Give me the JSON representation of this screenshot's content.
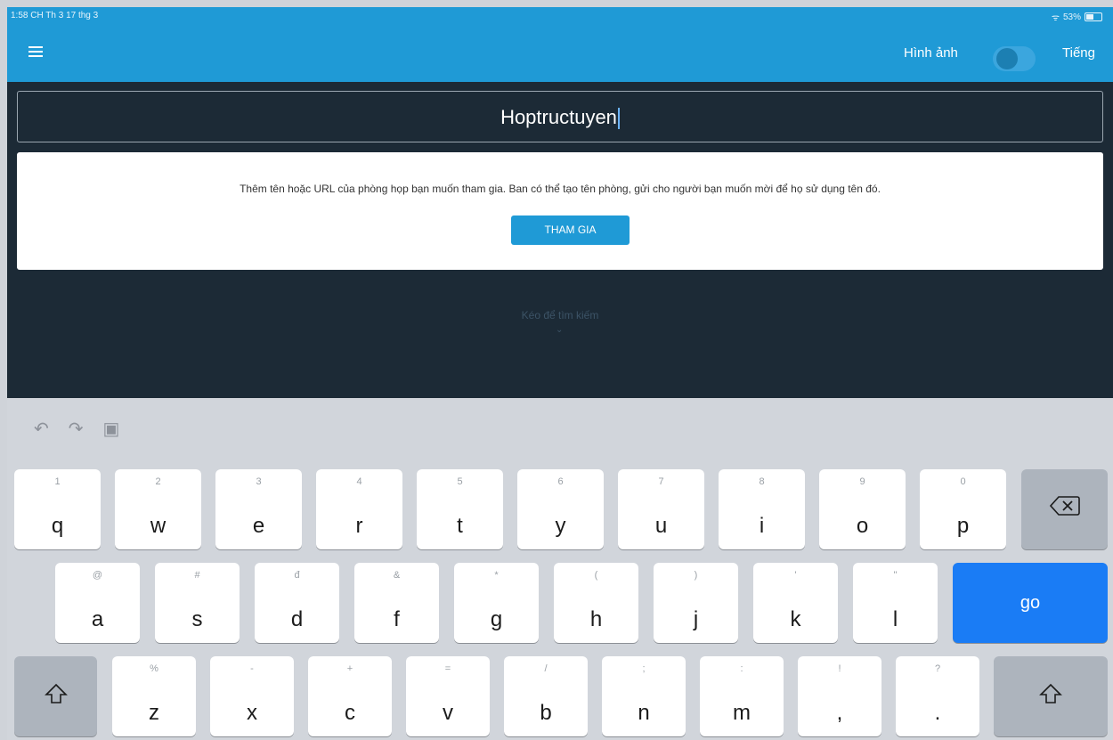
{
  "status_bar": {
    "time_date": "1:58 CH  Th 3 17 thg 3",
    "battery": "53%",
    "battery_level": 0.53
  },
  "header": {
    "menu_icon": "hamburger-menu-icon",
    "left_label": "Hình ảnh",
    "right_label": "Tiếng",
    "accent_color": "#1f9ad6"
  },
  "main": {
    "room_input_value": "Hoptructuyen",
    "info_text": "Thêm tên hoặc URL của phòng họp bạn muốn tham gia. Ban có thể tạo tên phòng, gửi cho người bạn muốn mời để họ sử dụng tên đó.",
    "join_button_label": "THAM GIA",
    "swipe_hint": "Kéo để tìm kiếm",
    "background_color": "#1c2a36"
  },
  "keyboard": {
    "toolbar_icons": [
      "undo-icon",
      "redo-icon",
      "paste-icon"
    ],
    "row1": [
      {
        "hint": "1",
        "label": "q"
      },
      {
        "hint": "2",
        "label": "w"
      },
      {
        "hint": "3",
        "label": "e"
      },
      {
        "hint": "4",
        "label": "r"
      },
      {
        "hint": "5",
        "label": "t"
      },
      {
        "hint": "6",
        "label": "y"
      },
      {
        "hint": "7",
        "label": "u"
      },
      {
        "hint": "8",
        "label": "i"
      },
      {
        "hint": "9",
        "label": "o"
      },
      {
        "hint": "0",
        "label": "p"
      }
    ],
    "row2": [
      {
        "hint": "@",
        "label": "a"
      },
      {
        "hint": "#",
        "label": "s"
      },
      {
        "hint": "đ",
        "label": "d"
      },
      {
        "hint": "&",
        "label": "f"
      },
      {
        "hint": "*",
        "label": "g"
      },
      {
        "hint": "(",
        "label": "h"
      },
      {
        "hint": ")",
        "label": "j"
      },
      {
        "hint": "'",
        "label": "k"
      },
      {
        "hint": "\"",
        "label": "l"
      }
    ],
    "row3": [
      {
        "hint": "%",
        "label": "z"
      },
      {
        "hint": "-",
        "label": "x"
      },
      {
        "hint": "+",
        "label": "c"
      },
      {
        "hint": "=",
        "label": "v"
      },
      {
        "hint": "/",
        "label": "b"
      },
      {
        "hint": ";",
        "label": "n"
      },
      {
        "hint": ":",
        "label": "m"
      },
      {
        "hint": "!",
        "label": ","
      },
      {
        "hint": "?",
        "label": "."
      }
    ],
    "go_label": "go",
    "go_color": "#1a7cf5",
    "delete_icon": "backspace-icon",
    "shift_icon": "shift-icon"
  }
}
